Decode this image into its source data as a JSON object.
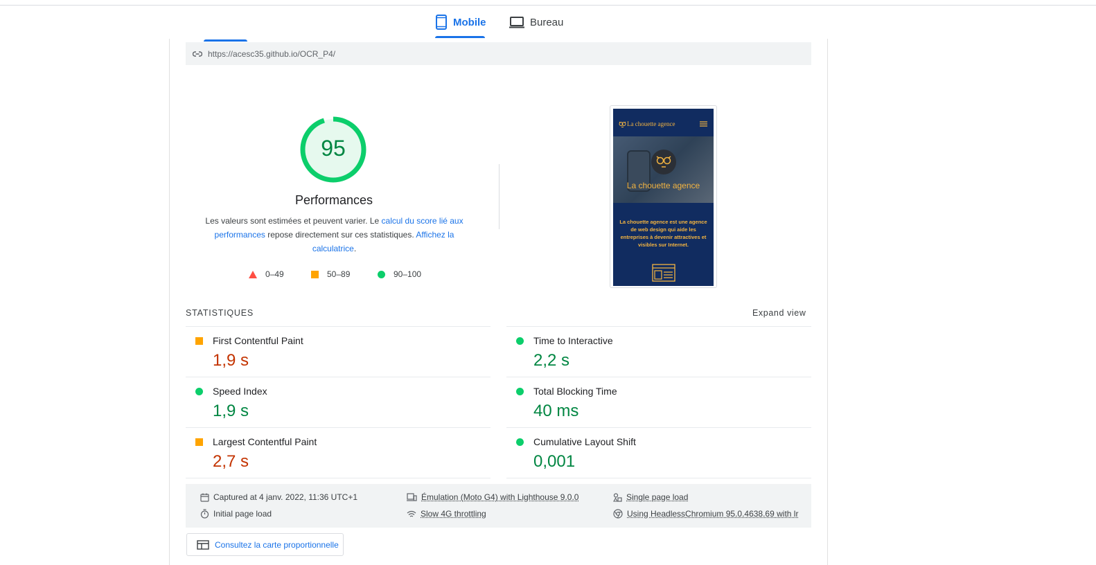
{
  "tabs": {
    "mobile": "Mobile",
    "desktop": "Bureau"
  },
  "url": "https://acesc35.github.io/OCR_P4/",
  "score": {
    "value": "95",
    "fraction": 0.95,
    "title": "Performances",
    "desc_prefix": "Les valeurs sont estimées et peuvent varier. Le ",
    "desc_link1": "calcul du score lié aux performances",
    "desc_mid": " repose directement sur ces statistiques. ",
    "desc_link2": "Affichez la calculatrice",
    "desc_suffix": "."
  },
  "legend": {
    "fail": "0–49",
    "average": "50–89",
    "pass": "90–100"
  },
  "screenshot": {
    "brand": "La chouette agence",
    "hero_title": "La chouette agence",
    "text": "La chouette agence est une agence de web design qui aide les entreprises à devenir attractives et visibles sur Internet."
  },
  "stats": {
    "header": "STATISTIQUES",
    "expand": "Expand view",
    "metrics": [
      {
        "label": "First Contentful Paint",
        "value": "1,9 s",
        "rating": "average"
      },
      {
        "label": "Time to Interactive",
        "value": "2,2 s",
        "rating": "pass"
      },
      {
        "label": "Speed Index",
        "value": "1,9 s",
        "rating": "pass"
      },
      {
        "label": "Total Blocking Time",
        "value": "40 ms",
        "rating": "pass"
      },
      {
        "label": "Largest Contentful Paint",
        "value": "2,7 s",
        "rating": "average"
      },
      {
        "label": "Cumulative Layout Shift",
        "value": "0,001",
        "rating": "pass"
      }
    ]
  },
  "footer": {
    "captured": "Captured at 4 janv. 2022, 11:36 UTC+1",
    "initial": "Initial page load",
    "emulation": "Émulation (Moto G4) with Lighthouse 9.0.0",
    "throttling": "Slow 4G throttling",
    "single": "Single page load",
    "browser": "Using HeadlessChromium 95.0.4638.69 with lr"
  },
  "treemap_button": "Consultez la carte proportionnelle",
  "colors": {
    "accent": "#1a73e8",
    "pass": "#0cce6b",
    "average": "#ffa400",
    "fail": "#ff4e42"
  }
}
